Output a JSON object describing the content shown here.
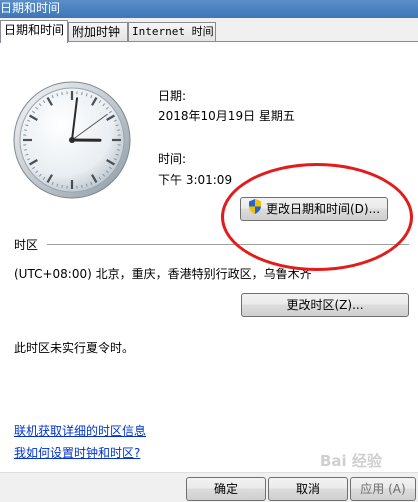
{
  "window": {
    "title": "日期和时间"
  },
  "tabs": [
    {
      "label": "日期和时间"
    },
    {
      "label": "附加时钟"
    },
    {
      "label": "Internet 时间"
    }
  ],
  "datetime": {
    "date_label": "日期:",
    "date_value": "2018年10月19日 星期五",
    "time_label": "时间:",
    "time_value": "下午 3:01:09",
    "change_button": "更改日期和时间(D)..."
  },
  "timezone": {
    "section_label": "时区",
    "value": "(UTC+08:00) 北京，重庆，香港特别行政区，乌鲁木齐",
    "change_button": "更改时区(Z)...",
    "dst_note": "此时区未实行夏令时。"
  },
  "links": {
    "more_info": "联机获取详细的时区信息",
    "how_to": "我如何设置时钟和时区?"
  },
  "footer": {
    "ok": "确定",
    "cancel": "取消",
    "apply": "应用 (A)"
  },
  "clock": {
    "hour": 3,
    "minute": 1,
    "second": 9
  },
  "watermark": {
    "text": "Bai 经验"
  },
  "colors": {
    "accent": "#3e76b8",
    "link": "#0033cc",
    "highlight_ring": "#e21b1b"
  }
}
